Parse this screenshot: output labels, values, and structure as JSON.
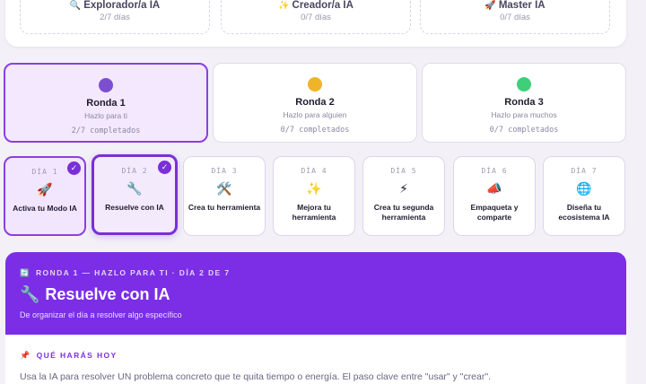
{
  "levels": [
    {
      "icon": "magnifier-icon",
      "emoji": "🔍",
      "title": "Explorador/a IA",
      "progress": "2/7 días"
    },
    {
      "icon": "sparkles-icon",
      "emoji": "✨",
      "title": "Creador/a IA",
      "progress": "0/7 días"
    },
    {
      "icon": "rocket-icon",
      "emoji": "🚀",
      "title": "Master IA",
      "progress": "0/7 días"
    }
  ],
  "rounds": [
    {
      "title": "Ronda 1",
      "subtitle": "Hazlo para ti",
      "progress": "2/7 completados",
      "color": "#7b4fd0",
      "active": true
    },
    {
      "title": "Ronda 2",
      "subtitle": "Hazlo para alguien",
      "progress": "0/7 completados",
      "color": "#f0b429",
      "active": false
    },
    {
      "title": "Ronda 3",
      "subtitle": "Hazlo para muchos",
      "progress": "0/7 completados",
      "color": "#3fcf7a",
      "active": false
    }
  ],
  "days": [
    {
      "label": "DÍA 1",
      "title": "Activa tu Modo IA",
      "icon": "rocket-icon",
      "emoji": "🚀",
      "state": "done",
      "check": "✓"
    },
    {
      "label": "DÍA 2",
      "title": "Resuelve con IA",
      "icon": "wrench-icon",
      "emoji": "🔧",
      "state": "current",
      "check": "✓"
    },
    {
      "label": "DÍA 3",
      "title": "Crea tu herramienta",
      "icon": "hammer-wrench-icon",
      "emoji": "🛠️",
      "state": "locked"
    },
    {
      "label": "DÍA 4",
      "title": "Mejora tu herramienta",
      "icon": "sparkles-icon",
      "emoji": "✨",
      "state": "locked"
    },
    {
      "label": "DÍA 5",
      "title": "Crea tu segunda herramienta",
      "icon": "lightning-icon",
      "emoji": "⚡",
      "state": "locked"
    },
    {
      "label": "DÍA 6",
      "title": "Empaqueta y comparte",
      "icon": "megaphone-icon",
      "emoji": "📣",
      "state": "locked"
    },
    {
      "label": "DÍA 7",
      "title": "Diseña tu ecosistema IA",
      "icon": "globe-icon",
      "emoji": "🌐",
      "state": "locked"
    }
  ],
  "hero": {
    "meta": "RONDA 1 — HAZLO PARA TI · DÍA 2 DE 7",
    "meta_icon": "🔄",
    "title": "Resuelve con IA",
    "title_icon": "🔧",
    "description": "De organizar el día a resolver algo específico"
  },
  "section": {
    "heading": "QUÉ HARÁS HOY",
    "heading_icon": "📌",
    "body": "Usa la IA para resolver UN problema concreto que te quita tiempo o energía. El paso clave entre \"usar\" y \"crear\"."
  },
  "colors": {
    "accent": "#7b2ee6",
    "accent_dark": "#7a2fd8"
  }
}
